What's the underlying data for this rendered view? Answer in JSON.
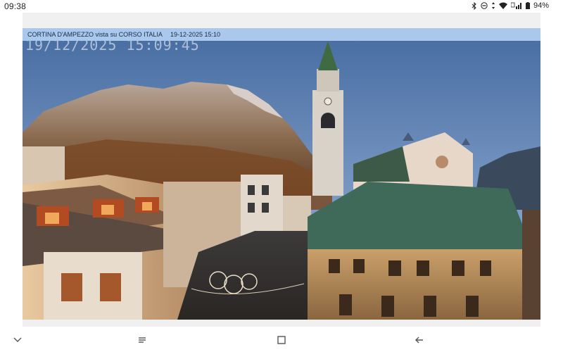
{
  "status_bar": {
    "time": "09:38",
    "battery_percent": "94%",
    "icons": [
      "bluetooth-icon",
      "do-not-disturb-icon",
      "data-arrows-icon",
      "wifi-icon",
      "lte-signal-icon",
      "battery-icon"
    ]
  },
  "webcam": {
    "title": "CORTINA D'AMPEZZO vista su CORSO ITALIA",
    "datetime": "19-12-2025 15:10",
    "overlay_timestamp": "19/12/2025 15:09:45"
  },
  "nav_bar": {
    "icons": [
      "chevron-down-icon",
      "recents-icon",
      "home-icon",
      "back-icon"
    ]
  }
}
